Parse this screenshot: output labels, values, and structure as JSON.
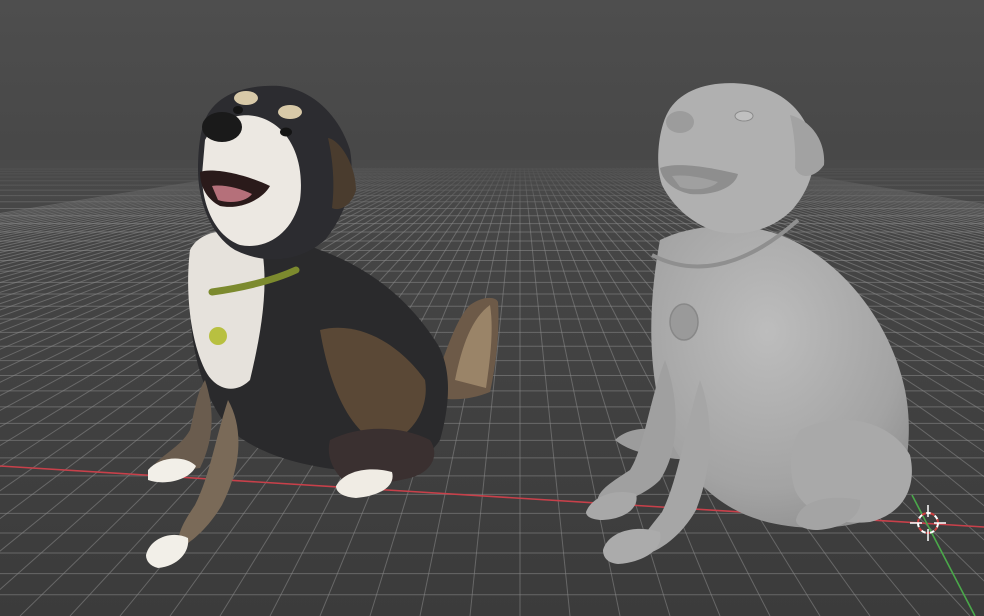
{
  "viewport": {
    "label": "",
    "background_top": "#505050",
    "background_bottom": "#3a3a3a",
    "grid_color": "#8a8a8a",
    "x_axis_color": "#c8404a",
    "y_axis_color": "#4aa84a"
  },
  "objects": [
    {
      "name": "photo-dog",
      "kind": "textured-photo"
    },
    {
      "name": "sculpt-dog",
      "kind": "gray-mesh",
      "color": "#a7a7a7"
    }
  ],
  "cursor": {
    "icon": "3d-cursor-icon"
  }
}
